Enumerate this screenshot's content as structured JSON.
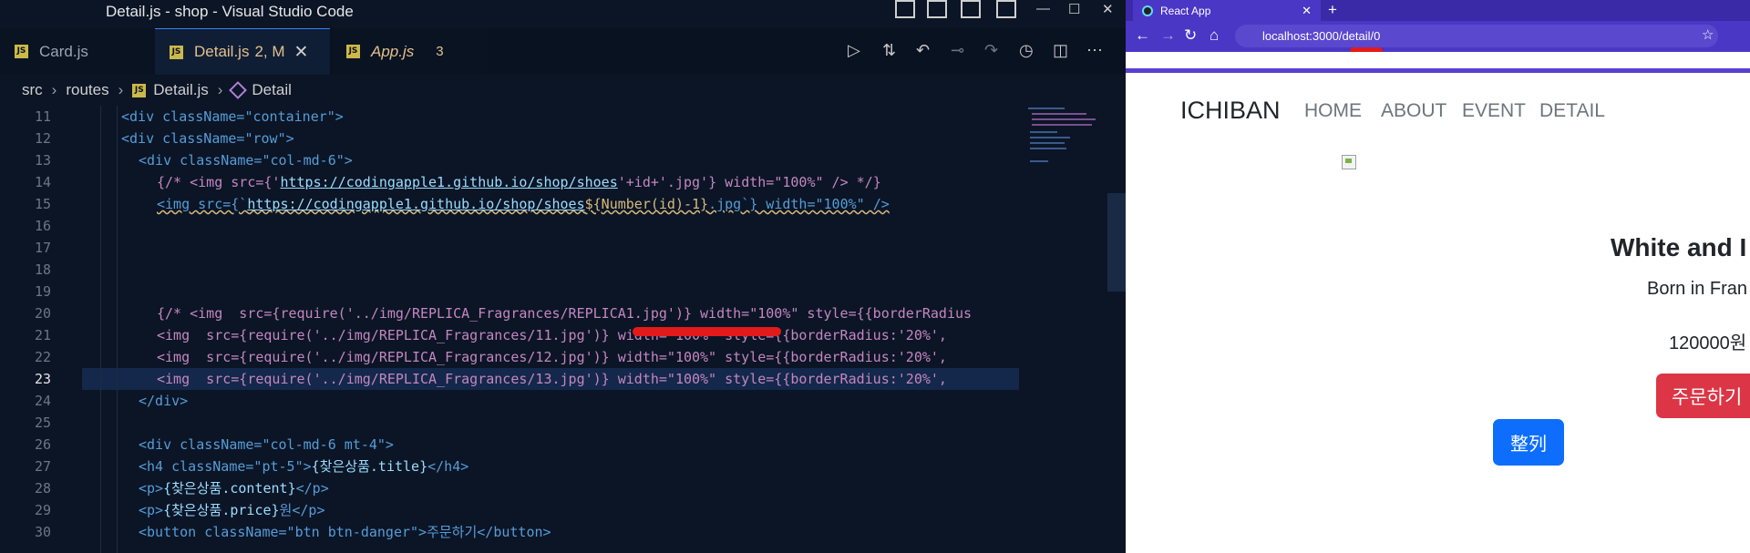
{
  "vscode": {
    "window_title": "Detail.js - shop - Visual Studio Code",
    "tabs": [
      {
        "label": "Card.js",
        "modifier": "",
        "count": ""
      },
      {
        "label": "Detail.js",
        "modifier": "2, M",
        "count": ""
      },
      {
        "label": "App.js",
        "modifier": "",
        "count": "3"
      }
    ],
    "breadcrumb": [
      "src",
      "routes",
      "Detail.js",
      "Detail"
    ],
    "line_numbers": [
      "11",
      "12",
      "13",
      "14",
      "15",
      "16",
      "17",
      "18",
      "19",
      "20",
      "21",
      "22",
      "23",
      "24",
      "25",
      "26",
      "27",
      "28",
      "29",
      "30"
    ],
    "code": {
      "l11": "<div className=\"container\">",
      "l12": "<div className=\"row\">",
      "l13": "<div className=\"col-md-6\">",
      "l14_a": "{/* <img src={'",
      "l14_link": "https://codingapple1.github.io/shop/shoes",
      "l14_b": "'+id+'.jpg'} width=\"100%\" /> */}",
      "l15_a": "<img src={`",
      "l15_link": "https://codingapple1.github.io/shop/shoes",
      "l15_b": "${Number(id)-1}",
      "l15_c": ".jpg`} width=\"100%\" />",
      "l20": "{/* <img  src={require('../img/REPLICA_Fragrances/REPLICA1.jpg')} width=\"100%\" style={{borderRadius",
      "l21": "<img  src={require('../img/REPLICA_Fragrances/11.jpg')} width=\"100%\" style={{borderRadius:'20%',",
      "l22": "<img  src={require('../img/REPLICA_Fragrances/12.jpg')} width=\"100%\" style={{borderRadius:'20%',",
      "l23": "<img  src={require('../img/REPLICA_Fragrances/13.jpg')} width=\"100%\" style={{borderRadius:'20%',",
      "l24": "</div>",
      "l26": "<div className=\"col-md-6 mt-4\">",
      "l27_a": "<h4 className=\"pt-5\">",
      "l27_b": "{찾은상품.title}",
      "l27_c": "</h4>",
      "l28_a": "<p>",
      "l28_b": "{찾은상품.content}",
      "l28_c": "</p>",
      "l29_a": "<p>",
      "l29_b": "{찾은상품.price}",
      "l29_c": "원</p>",
      "l30": "<button className=\"btn btn-danger\">주문하기</button>"
    },
    "colors": {
      "editor_bg": "#0b1526",
      "accent": "#3b82f6",
      "annotation": "#e21a1a"
    }
  },
  "browser": {
    "tab_title": "React App",
    "url": "localhost:3000/detail/0",
    "navbar": {
      "brand": "ICHIBAN",
      "links": [
        "HOME",
        "ABOUT",
        "EVENT",
        "DETAIL"
      ]
    },
    "product": {
      "title": "White and I",
      "content": "Born in Fran",
      "price": "120000원"
    },
    "order_button": "주문하기",
    "sort_button": "整列",
    "colors": {
      "theme": "#4a37c5",
      "danger": "#dc3545",
      "primary": "#0d6efd"
    }
  }
}
